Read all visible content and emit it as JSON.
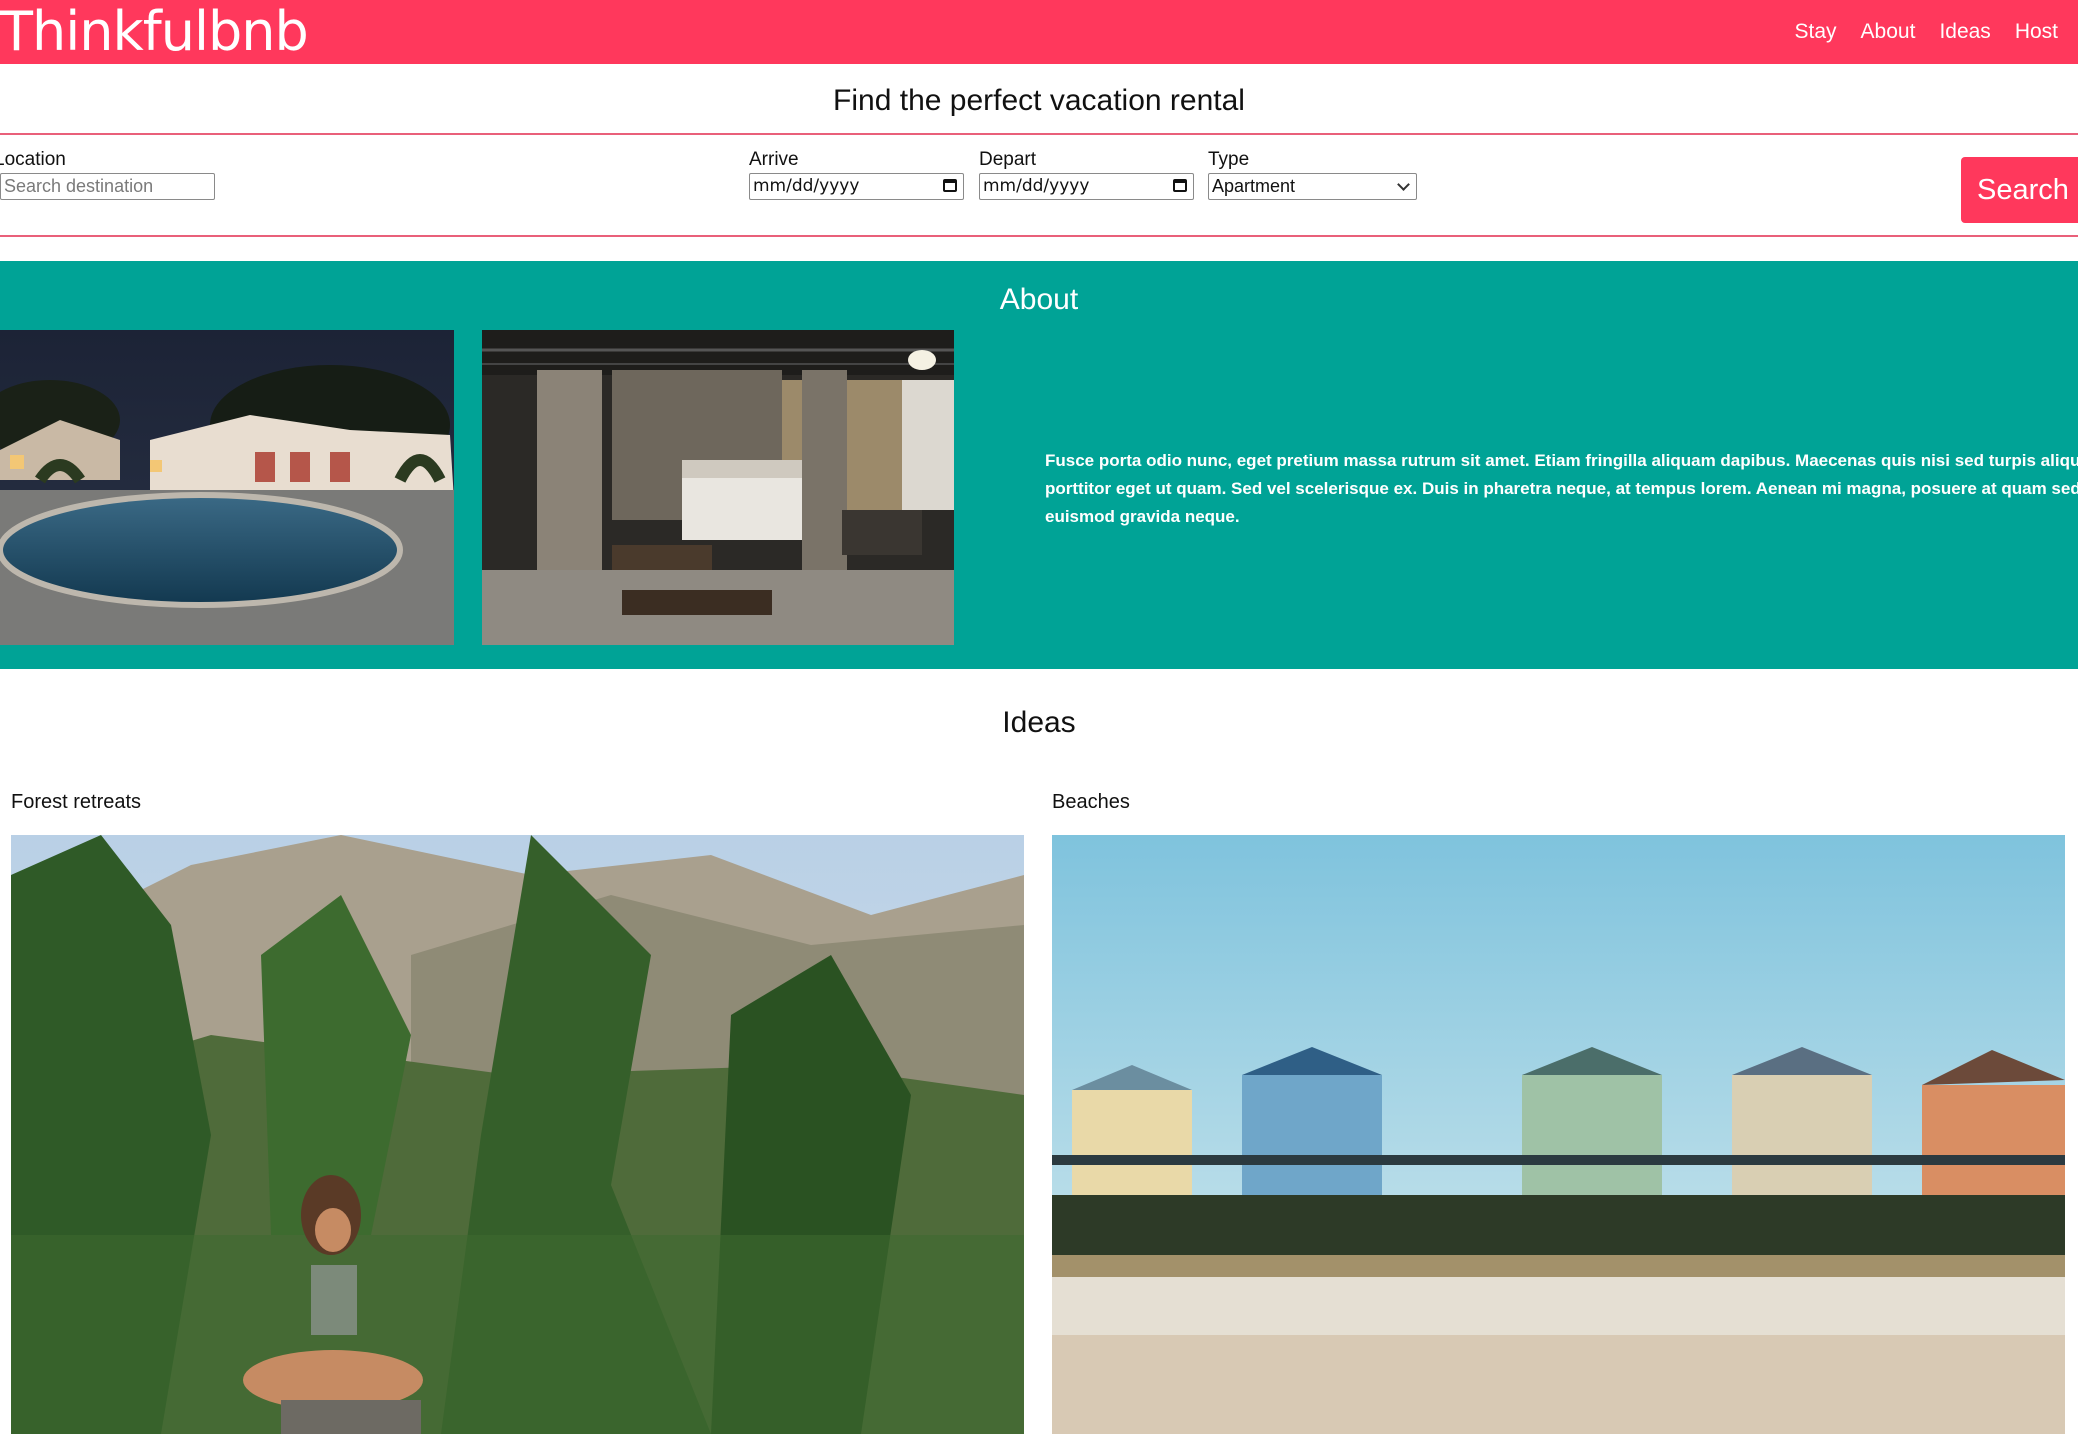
{
  "header": {
    "logo": "Thinkfulbnb",
    "nav": [
      "Stay",
      "About",
      "Ideas",
      "Host"
    ]
  },
  "search": {
    "title": "Find the perfect vacation rental",
    "location_label": "Location",
    "location_placeholder": "Search destination",
    "arrive_label": "Arrive",
    "arrive_value": "mm/dd/yyyy",
    "depart_label": "Depart",
    "depart_value": "mm/dd/yyyy",
    "type_label": "Type",
    "type_selected": "Apartment",
    "button_label": "Search"
  },
  "about": {
    "title": "About",
    "text_lines": [
      "Fusce porta odio nunc, eget pretium massa rutrum sit amet. Etiam fringilla aliquam dapibus. Maecenas quis nisi sed turpis aliquam",
      "porttitor eget ut quam. Sed vel scelerisque ex. Duis in pharetra neque, at tempus lorem. Aenean mi magna, posuere at quam sed,",
      "euismod gravida neque."
    ]
  },
  "ideas": {
    "title": "Ideas",
    "items": [
      {
        "label": "Forest retreats"
      },
      {
        "label": "Beaches"
      }
    ]
  },
  "colors": {
    "brand": "#ff385c",
    "about_bg": "#00a396"
  }
}
